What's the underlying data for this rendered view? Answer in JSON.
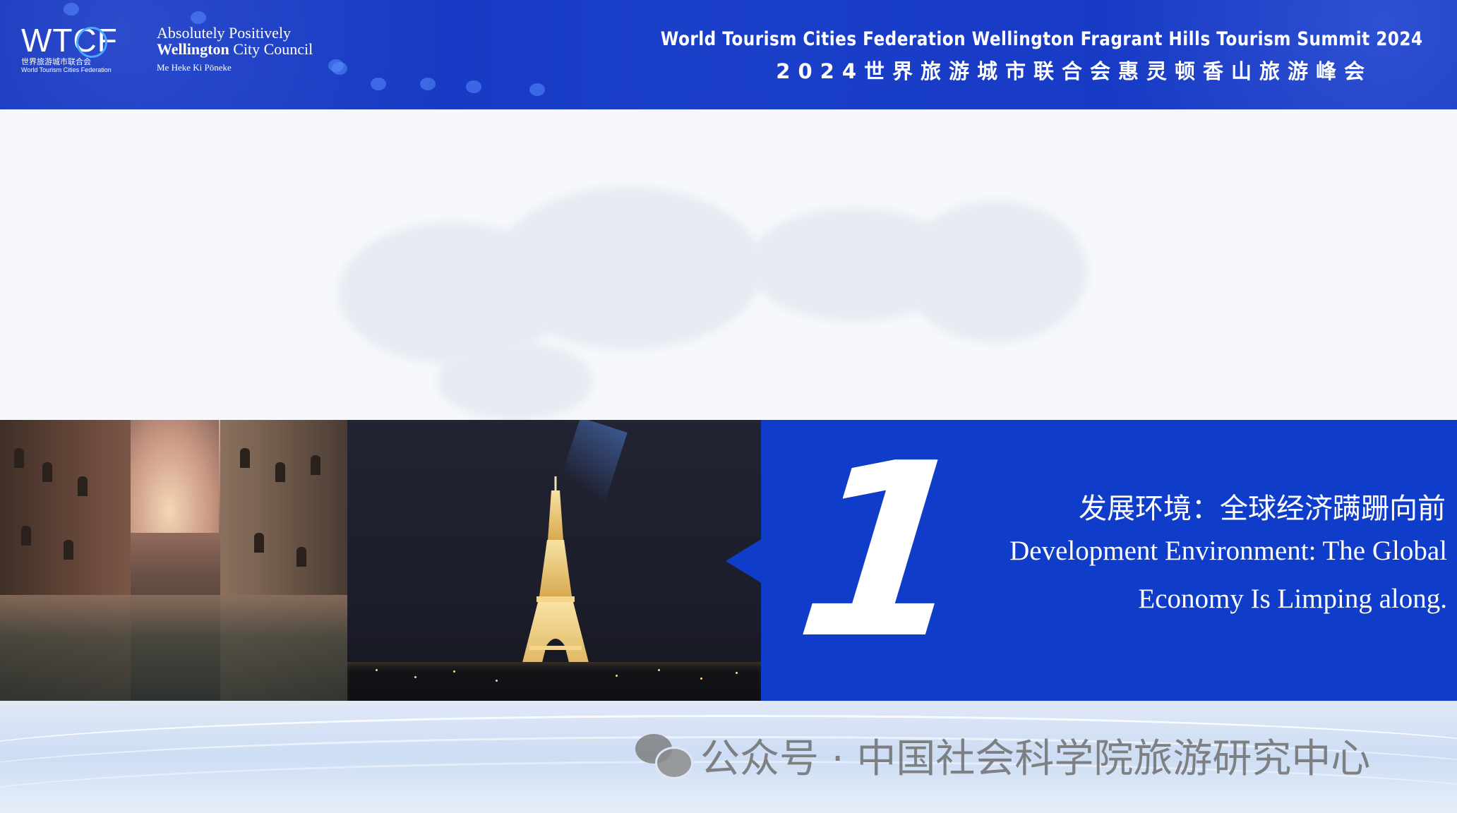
{
  "header": {
    "wtcf_logo_text": "WTCF",
    "wtcf_logo_cn": "世界旅游城市联合会",
    "wtcf_logo_en": "World Tourism Cities Federation",
    "council_line1": "Absolutely Positively",
    "council_line2_bold": "Wellington",
    "council_line2_rest": " City Council",
    "council_line3": "Me Heke Ki Pōneke",
    "title_en": "World Tourism Cities Federation Wellington Fragrant Hills Tourism Summit 2024",
    "title_cn": "2024世界旅游城市联合会惠灵顿香山旅游峰会"
  },
  "section": {
    "number": "1",
    "title_cn": "发展环境：全球经济蹒跚向前",
    "title_en_line1": "Development Environment: The Global",
    "title_en_line2": "Economy Is Limping along."
  },
  "watermark": {
    "icon": "wechat-icon",
    "text": "公众号 · 中国社会科学院旅游研究中心"
  },
  "colors": {
    "header_blue": "#1a3fc9",
    "panel_blue": "#0f3dc9",
    "text_white": "#ffffff"
  }
}
